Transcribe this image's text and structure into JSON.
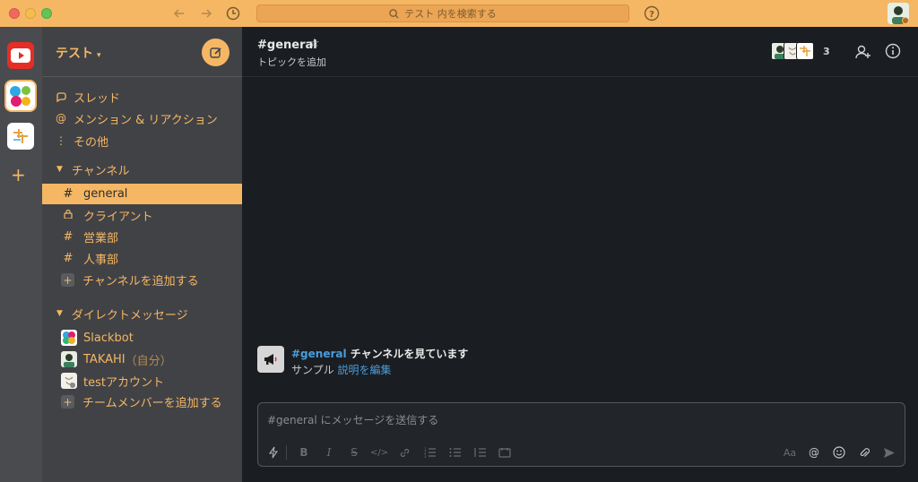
{
  "titlebar": {
    "search_placeholder": "テスト 内を検索する"
  },
  "workspace": {
    "name": "テスト"
  },
  "sidebar": {
    "nav": [
      {
        "label": "スレッド",
        "icon": "threads-icon"
      },
      {
        "label": "メンション & リアクション",
        "icon": "mention-icon"
      },
      {
        "label": "その他",
        "icon": "more-icon"
      }
    ],
    "channels_header": "チャンネル",
    "channels": [
      {
        "label": "general",
        "icon": "hash-icon",
        "active": true
      },
      {
        "label": "クライアント",
        "icon": "lock-icon"
      },
      {
        "label": "営業部",
        "icon": "hash-icon"
      },
      {
        "label": "人事部",
        "icon": "hash-icon"
      }
    ],
    "add_channel": "チャンネルを追加する",
    "dm_header": "ダイレクトメッセージ",
    "dms": [
      {
        "label": "Slackbot",
        "suffix": ""
      },
      {
        "label": "TAKAHI",
        "suffix": "（自分）"
      },
      {
        "label": "testアカウント",
        "suffix": ""
      }
    ],
    "add_member": "チームメンバーを追加する"
  },
  "channel": {
    "title": "#general",
    "topic": "トピックを追加",
    "member_count": "3"
  },
  "intro": {
    "channel_link": "#general",
    "line1_rest": " チャンネルを見ています",
    "line2_prefix": "サンプル ",
    "edit_link": "説明を編集"
  },
  "composer": {
    "placeholder": "#general にメッセージを送信する",
    "format_label": "Aa"
  },
  "colors": {
    "accent": "#f5b764",
    "sidebar": "#414246",
    "rail": "#494b4f",
    "main": "#1a1d21",
    "link": "#4a9edb"
  }
}
